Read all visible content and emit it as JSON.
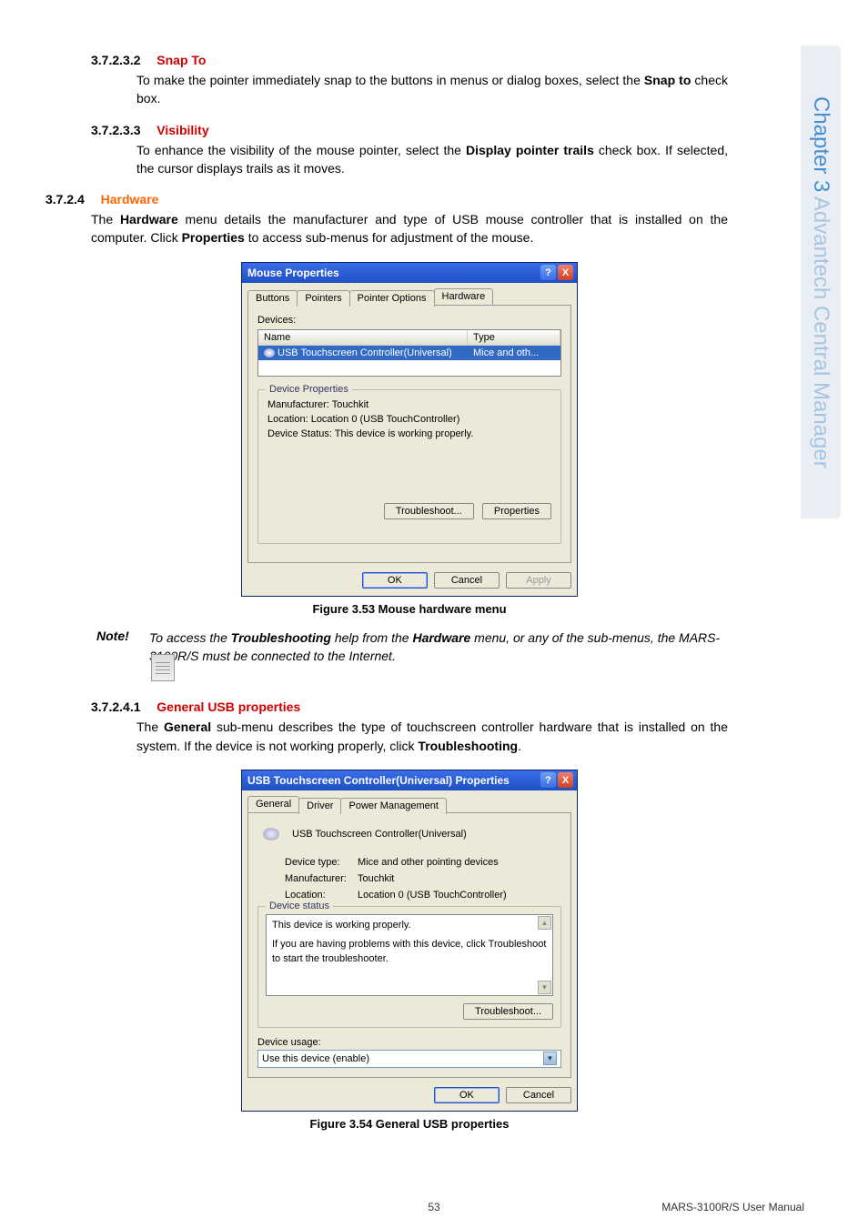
{
  "side_tab": {
    "prefix": "Chapter 3",
    "suffix": "  Advantech Central Manager"
  },
  "s1": {
    "num": "3.7.2.3.2",
    "title": "Snap To",
    "body_a": "To make the pointer immediately snap to the buttons in menus or dialog boxes, select the ",
    "body_bold": "Snap to",
    "body_b": " check box."
  },
  "s2": {
    "num": "3.7.2.3.3",
    "title": "Visibility",
    "body_a": "To enhance the visibility of the mouse pointer, select the ",
    "body_bold": "Display pointer trails",
    "body_b": " check box. If selected, the cursor displays trails as it moves."
  },
  "s3": {
    "num": "3.7.2.4",
    "title": "Hardware",
    "body_a": "The ",
    "body_bold1": "Hardware",
    "body_b": " menu details the manufacturer and type of USB mouse controller that is installed on the computer. Click ",
    "body_bold2": "Properties",
    "body_c": " to access sub-menus for adjustment of the mouse."
  },
  "mouse_dialog": {
    "title": "Mouse Properties",
    "help": "?",
    "close": "X",
    "tabs": [
      "Buttons",
      "Pointers",
      "Pointer Options",
      "Hardware"
    ],
    "devices_label": "Devices:",
    "col_name": "Name",
    "col_type": "Type",
    "row_name": "USB Touchscreen Controller(Universal)",
    "row_type": "Mice and oth...",
    "props_legend": "Device Properties",
    "manufacturer": "Manufacturer: Touchkit",
    "location": "Location: Location 0 (USB TouchController)",
    "status": "Device Status: This device is working properly.",
    "troubleshoot": "Troubleshoot...",
    "properties": "Properties",
    "ok": "OK",
    "cancel": "Cancel",
    "apply": "Apply"
  },
  "fig1_caption": "Figure 3.53 Mouse hardware menu",
  "note": {
    "label": "Note!",
    "text_a": "To access the ",
    "bold1": "Troubleshooting",
    "text_b": " help from the ",
    "bold2": "Hardware",
    "text_c": " menu, or any of the sub-menus, the MARS-3100R/S must be connected to the Internet."
  },
  "s4": {
    "num": "3.7.2.4.1",
    "title": "General USB properties",
    "body_a": "The ",
    "body_bold": "General",
    "body_b": " sub-menu describes the type of touchscreen controller hardware that is installed on the system. If the device is not working properly, click ",
    "body_bold2": "Troubleshooting",
    "body_c": "."
  },
  "usb_dialog": {
    "title": "USB Touchscreen Controller(Universal) Properties",
    "help": "?",
    "close": "X",
    "tabs": [
      "General",
      "Driver",
      "Power Management"
    ],
    "dev_name": "USB Touchscreen Controller(Universal)",
    "rows": [
      {
        "k": "Device type:",
        "v": "Mice and other pointing devices"
      },
      {
        "k": "Manufacturer:",
        "v": "Touchkit"
      },
      {
        "k": "Location:",
        "v": "Location 0 (USB TouchController)"
      }
    ],
    "status_legend": "Device status",
    "status_line1": "This device is working properly.",
    "status_line2": "If you are having problems with this device, click Troubleshoot to start the troubleshooter.",
    "troubleshoot": "Troubleshoot...",
    "usage_label": "Device usage:",
    "usage_value": "Use this device (enable)",
    "ok": "OK",
    "cancel": "Cancel"
  },
  "fig2_caption": "Figure 3.54 General USB properties",
  "footer": {
    "page": "53",
    "right": "MARS-3100R/S User Manual"
  }
}
